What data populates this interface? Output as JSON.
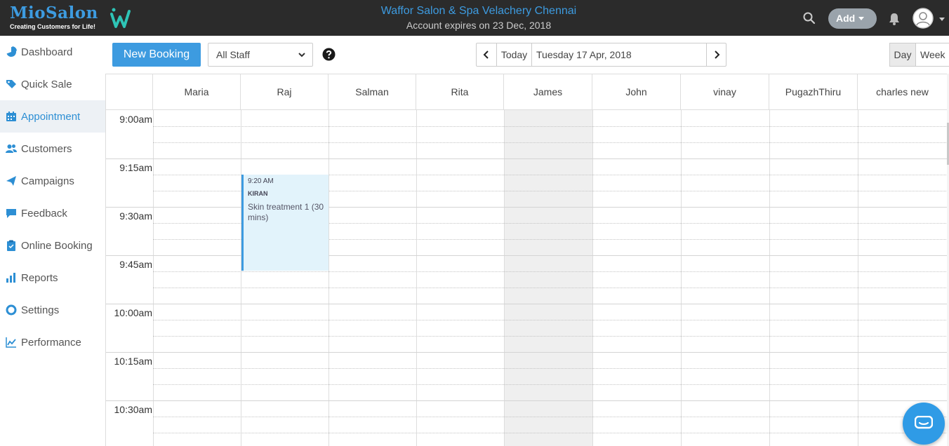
{
  "brand": {
    "name": "MioSalon",
    "tagline": "Creating Customers for Life!"
  },
  "header": {
    "salon_name": "Waffor Salon & Spa Velachery Chennai",
    "expiry": "Account expires on 23 Dec, 2018",
    "add_label": "Add"
  },
  "sidebar": {
    "items": [
      {
        "label": "Dashboard",
        "icon": "pie-chart-icon"
      },
      {
        "label": "Quick Sale",
        "icon": "tag-icon"
      },
      {
        "label": "Appointment",
        "icon": "calendar-icon",
        "active": true
      },
      {
        "label": "Customers",
        "icon": "users-icon"
      },
      {
        "label": "Campaigns",
        "icon": "paper-plane-icon"
      },
      {
        "label": "Feedback",
        "icon": "comment-icon"
      },
      {
        "label": "Online Booking",
        "icon": "clipboard-icon"
      },
      {
        "label": "Reports",
        "icon": "bar-chart-icon"
      },
      {
        "label": "Settings",
        "icon": "life-ring-icon"
      },
      {
        "label": "Performance",
        "icon": "line-chart-icon"
      }
    ]
  },
  "toolbar": {
    "new_booking": "New Booking",
    "staff_filter": "All Staff",
    "today": "Today",
    "date": "Tuesday 17 Apr, 2018",
    "view_day": "Day",
    "view_week": "Week"
  },
  "calendar": {
    "staff": [
      "Maria",
      "Raj",
      "Salman",
      "Rita",
      "James",
      "John",
      "vinay",
      "PugazhThiru",
      "charles new"
    ],
    "unavailable_staff": [
      "James"
    ],
    "time_labels": [
      "9:00am",
      "9:15am",
      "9:30am",
      "9:45am",
      "10:00am",
      "10:15am",
      "10:30am"
    ],
    "appointments": [
      {
        "staff": "Raj",
        "time": "9:20 AM",
        "customer": "KIRAN",
        "service": "Skin treatment 1 (30 mins)"
      }
    ]
  },
  "colors": {
    "accent": "#3d9be0",
    "topbar": "#2b2b2b",
    "appointment_bg": "#e2f3fb"
  }
}
